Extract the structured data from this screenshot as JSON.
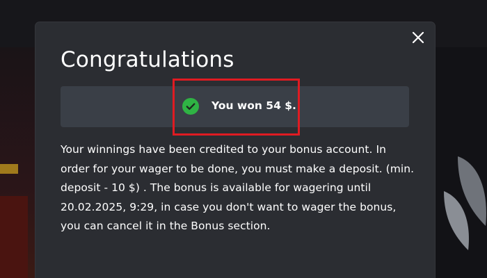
{
  "modal": {
    "title": "Congratulations",
    "close_icon": "close-icon",
    "banner": {
      "icon": "check-circle-icon",
      "icon_color": "#2fb344",
      "text": "You won 54 $."
    },
    "message": "Your winnings have been credited to your bonus account. In order for your wager to be done, you must make a deposit. (min. deposit - 10 $) . The bonus is available for wagering until 20.02.2025, 9:29, in case you don't want to wager the bonus, you can cancel it in the Bonus section."
  },
  "colors": {
    "modal_background": "#2b2d32",
    "banner_background": "#3a3f47",
    "highlight": "#e01b22",
    "text": "#ffffff"
  }
}
